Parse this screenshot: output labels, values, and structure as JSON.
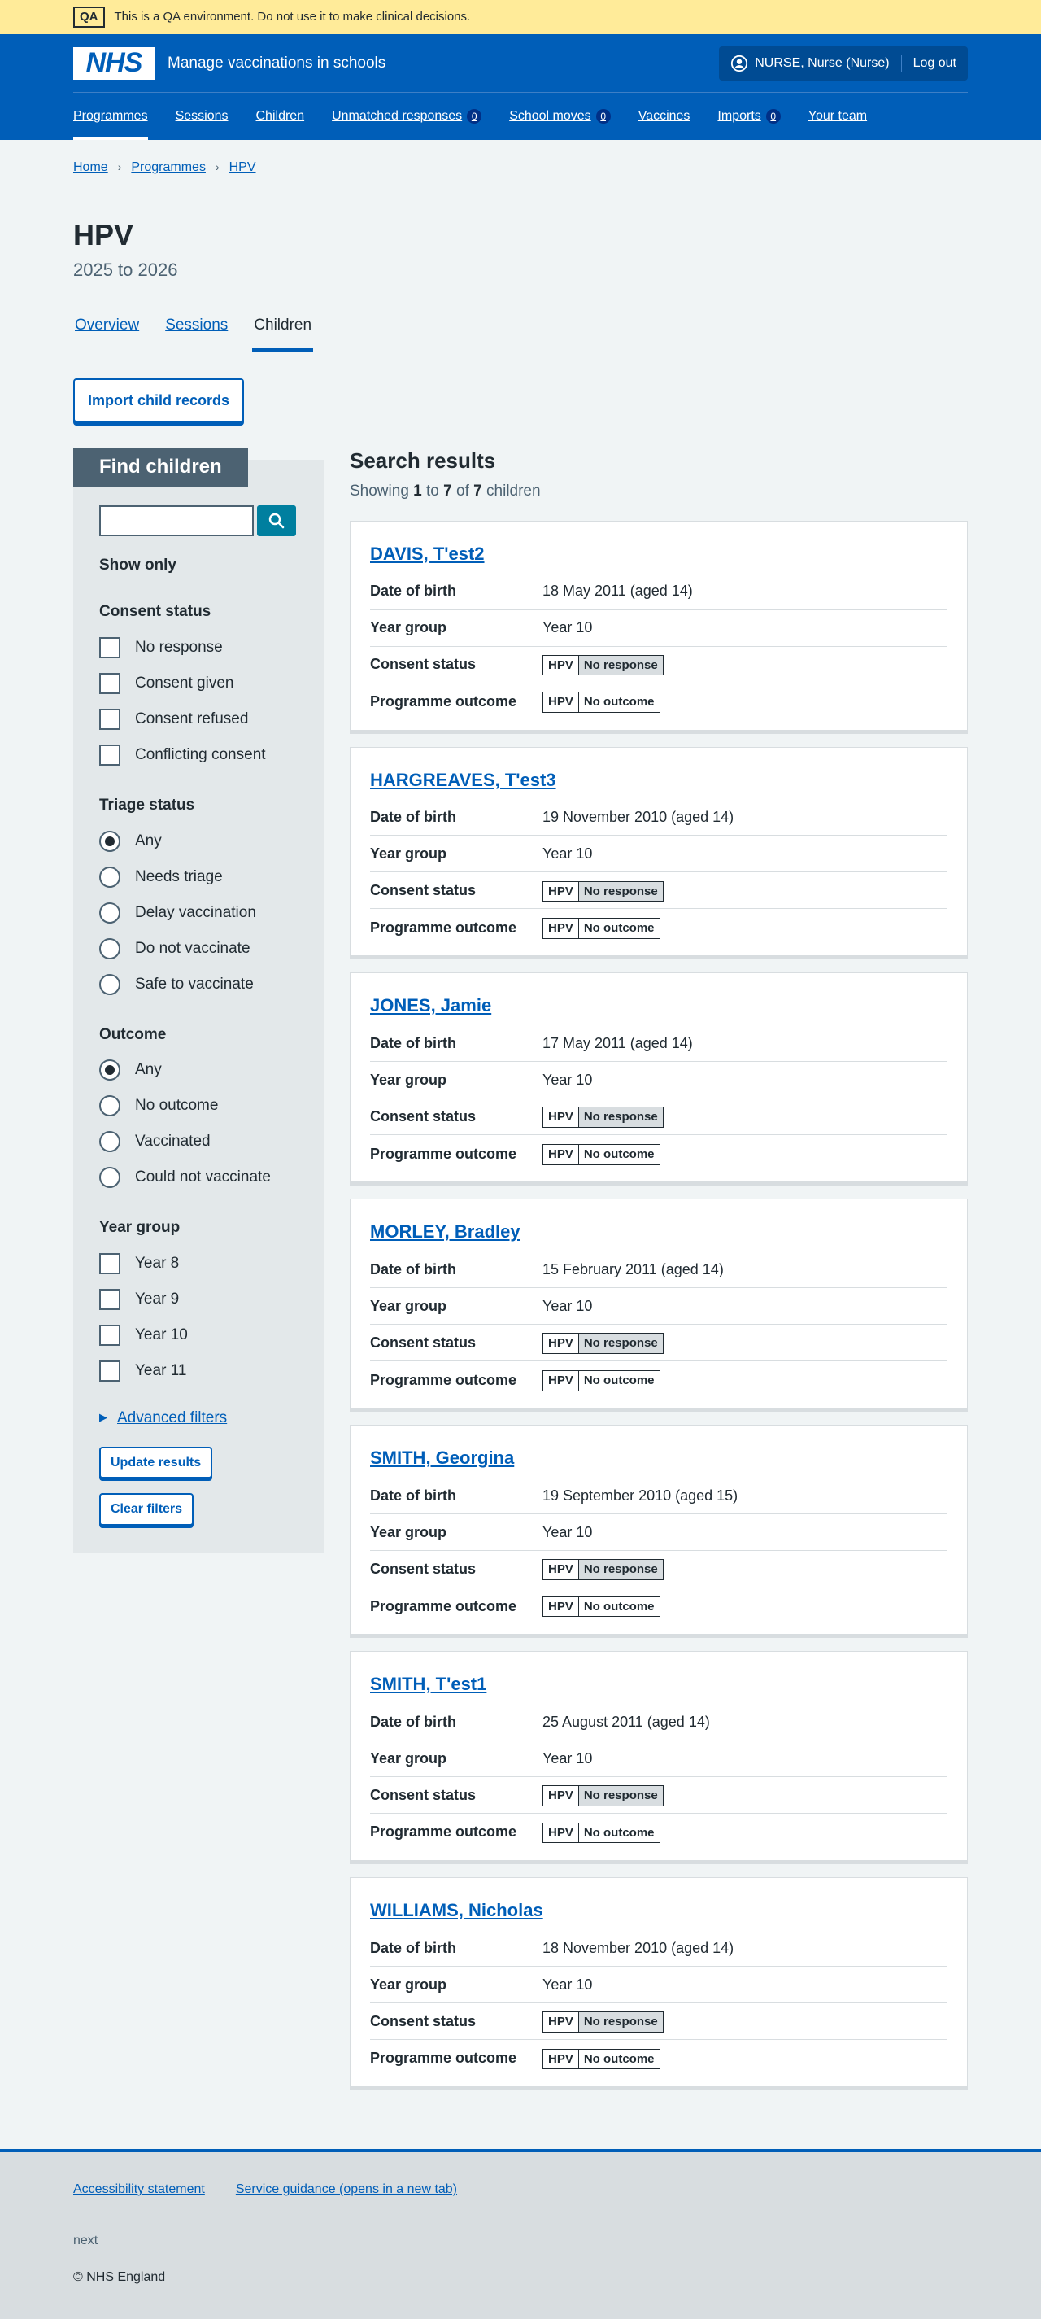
{
  "qa": {
    "tag": "QA",
    "message": "This is a QA environment. Do not use it to make clinical decisions."
  },
  "header": {
    "logo": "NHS",
    "service_name": "Manage vaccinations in schools",
    "user": "NURSE, Nurse (Nurse)",
    "logout": "Log out"
  },
  "nav": [
    {
      "label": "Programmes",
      "count": null
    },
    {
      "label": "Sessions",
      "count": null
    },
    {
      "label": "Children",
      "count": null
    },
    {
      "label": "Unmatched responses",
      "count": "0"
    },
    {
      "label": "School moves",
      "count": "0"
    },
    {
      "label": "Vaccines",
      "count": null
    },
    {
      "label": "Imports",
      "count": "0"
    },
    {
      "label": "Your team",
      "count": null
    }
  ],
  "breadcrumb": [
    "Home",
    "Programmes",
    "HPV"
  ],
  "page": {
    "title": "HPV",
    "caption": "2025 to 2026"
  },
  "tabs": [
    "Overview",
    "Sessions",
    "Children"
  ],
  "import_button": "Import child records",
  "filters": {
    "heading": "Find children",
    "search_placeholder": "",
    "show_only": "Show only",
    "consent": {
      "title": "Consent status",
      "options": [
        "No response",
        "Consent given",
        "Consent refused",
        "Conflicting consent"
      ]
    },
    "triage": {
      "title": "Triage status",
      "options": [
        "Any",
        "Needs triage",
        "Delay vaccination",
        "Do not vaccinate",
        "Safe to vaccinate"
      ]
    },
    "outcome": {
      "title": "Outcome",
      "options": [
        "Any",
        "No outcome",
        "Vaccinated",
        "Could not vaccinate"
      ]
    },
    "year": {
      "title": "Year group",
      "options": [
        "Year 8",
        "Year 9",
        "Year 10",
        "Year 11"
      ]
    },
    "advanced": "Advanced filters",
    "update": "Update results",
    "clear": "Clear filters"
  },
  "results": {
    "heading": "Search results",
    "showing_prefix": "Showing",
    "from": "1",
    "to_word": "to",
    "to": "7",
    "of_word": "of",
    "total": "7",
    "suffix": "children",
    "labels": {
      "dob": "Date of birth",
      "year": "Year group",
      "consent": "Consent status",
      "outcome": "Programme outcome"
    },
    "children": [
      {
        "name": "DAVIS, T'est2",
        "dob": "18 May 2011 (aged 14)",
        "year": "Year 10",
        "programme": "HPV",
        "consent": "No response",
        "outcome": "No outcome"
      },
      {
        "name": "HARGREAVES, T'est3",
        "dob": "19 November 2010 (aged 14)",
        "year": "Year 10",
        "programme": "HPV",
        "consent": "No response",
        "outcome": "No outcome"
      },
      {
        "name": "JONES, Jamie",
        "dob": "17 May 2011 (aged 14)",
        "year": "Year 10",
        "programme": "HPV",
        "consent": "No response",
        "outcome": "No outcome"
      },
      {
        "name": "MORLEY, Bradley",
        "dob": "15 February 2011 (aged 14)",
        "year": "Year 10",
        "programme": "HPV",
        "consent": "No response",
        "outcome": "No outcome"
      },
      {
        "name": "SMITH, Georgina",
        "dob": "19 September 2010 (aged 15)",
        "year": "Year 10",
        "programme": "HPV",
        "consent": "No response",
        "outcome": "No outcome"
      },
      {
        "name": "SMITH, T'est1",
        "dob": "25 August 2011 (aged 14)",
        "year": "Year 10",
        "programme": "HPV",
        "consent": "No response",
        "outcome": "No outcome"
      },
      {
        "name": "WILLIAMS, Nicholas",
        "dob": "18 November 2010 (aged 14)",
        "year": "Year 10",
        "programme": "HPV",
        "consent": "No response",
        "outcome": "No outcome"
      }
    ]
  },
  "footer": {
    "links": [
      "Accessibility statement",
      "Service guidance (opens in a new tab)"
    ],
    "version": "next",
    "copyright": "© NHS England"
  }
}
